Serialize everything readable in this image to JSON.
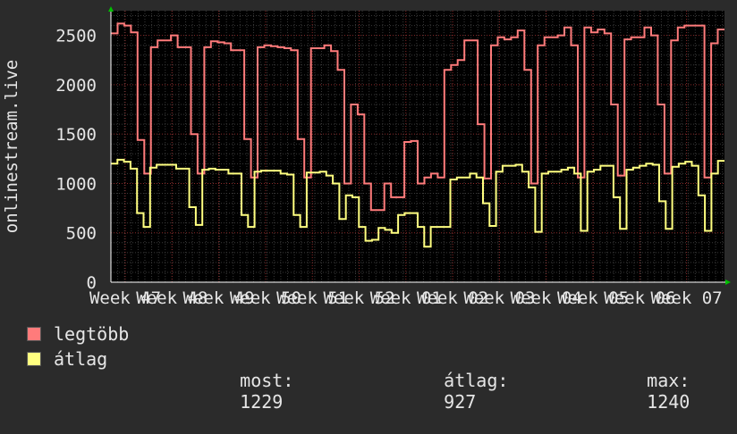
{
  "chart_data": {
    "type": "line",
    "ylabel": "onlinestream.live",
    "y_ticks": [
      0,
      500,
      1000,
      1500,
      2000,
      2500
    ],
    "ylim": [
      0,
      2750
    ],
    "x_ticks": [
      "Week 47",
      "Week 48",
      "Week 49",
      "Week 50",
      "Week 51",
      "Week 52",
      "Week 01",
      "Week 02",
      "Week 03",
      "Week 04",
      "Week 05",
      "Week 06",
      "Week 07"
    ],
    "grid": true,
    "series": [
      {
        "name": "legtöbb",
        "color": "#ff7b7b",
        "values": [
          2520,
          2620,
          2600,
          2530,
          1440,
          1100,
          2380,
          2450,
          2450,
          2500,
          2380,
          2380,
          1500,
          1100,
          2380,
          2440,
          2430,
          2420,
          2350,
          2350,
          1450,
          1060,
          2380,
          2400,
          2390,
          2380,
          2370,
          2350,
          1450,
          1060,
          2370,
          2370,
          2400,
          2340,
          2150,
          1000,
          1800,
          1700,
          1000,
          730,
          730,
          1000,
          860,
          860,
          1420,
          1430,
          1000,
          1060,
          1100,
          1060,
          2150,
          2200,
          2250,
          2450,
          2450,
          1600,
          1050,
          2400,
          2480,
          2460,
          2480,
          2550,
          2150,
          1000,
          2400,
          2480,
          2480,
          2500,
          2580,
          2400,
          1060,
          2580,
          2530,
          2560,
          2520,
          1800,
          1080,
          2460,
          2480,
          2480,
          2580,
          2500,
          1800,
          1100,
          2450,
          2580,
          2600,
          2600,
          2600,
          1060,
          2420,
          2560
        ]
      },
      {
        "name": "átlag",
        "color": "#ffff80",
        "values": [
          1200,
          1240,
          1220,
          1150,
          700,
          560,
          1160,
          1190,
          1190,
          1190,
          1150,
          1150,
          760,
          580,
          1140,
          1150,
          1140,
          1140,
          1100,
          1100,
          680,
          560,
          1120,
          1130,
          1130,
          1130,
          1100,
          1090,
          680,
          560,
          1110,
          1110,
          1120,
          1080,
          1000,
          640,
          880,
          860,
          560,
          420,
          430,
          550,
          530,
          500,
          680,
          700,
          700,
          560,
          360,
          560,
          560,
          560,
          1040,
          1060,
          1060,
          1100,
          1060,
          800,
          570,
          1120,
          1180,
          1180,
          1190,
          1120,
          960,
          510,
          1100,
          1120,
          1120,
          1140,
          1160,
          1100,
          520,
          1120,
          1140,
          1180,
          1180,
          860,
          540,
          1140,
          1160,
          1180,
          1200,
          1190,
          820,
          540,
          1170,
          1200,
          1220,
          1180,
          880,
          520,
          1100,
          1229
        ]
      }
    ]
  },
  "legend": {
    "items": [
      {
        "label": "legtöbb",
        "color": "#ff7b7b"
      },
      {
        "label": "átlag",
        "color": "#ffff80"
      }
    ],
    "stats": {
      "most_label": "most:",
      "most_value": "1229",
      "avg_label": "átlag:",
      "avg_value": "927",
      "max_label": "max:",
      "max_value": "1240"
    }
  }
}
